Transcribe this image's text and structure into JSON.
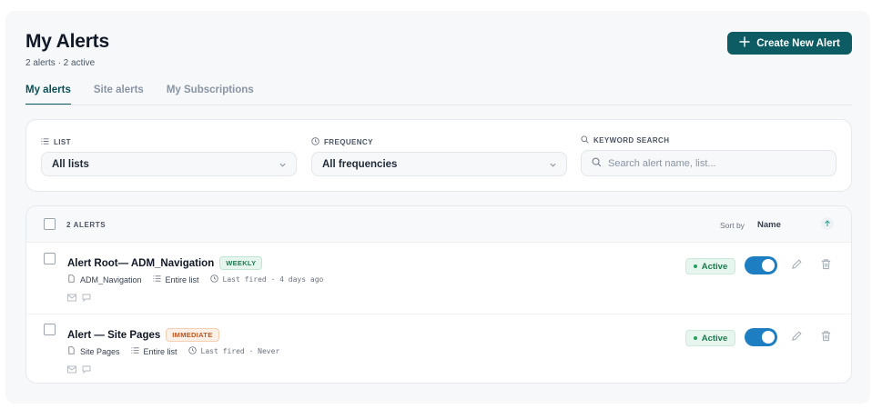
{
  "header": {
    "title": "My Alerts",
    "subtitle": "2 alerts · 2 active",
    "create_button": "Create New Alert"
  },
  "tabs": [
    {
      "label": "My alerts",
      "active": true
    },
    {
      "label": "Site alerts",
      "active": false
    },
    {
      "label": "My Subscriptions",
      "active": false
    }
  ],
  "filters": {
    "list": {
      "label": "LIST",
      "value": "All lists"
    },
    "frequency": {
      "label": "FREQUENCY",
      "value": "All frequencies"
    },
    "keyword": {
      "label": "KEYWORD SEARCH",
      "placeholder": "Search alert name, list..."
    }
  },
  "list_header": {
    "count_label": "2 ALERTS",
    "sort_by_label": "Sort by",
    "sort_value": "Name",
    "sort_direction": "ascending"
  },
  "alerts": [
    {
      "name": "Alert Root— ADM_Navigation",
      "frequency": "WEEKLY",
      "site": "ADM_Navigation",
      "scope": "Entire list",
      "last_fired": "Last fired · 4 days ago",
      "status": "Active",
      "enabled": true
    },
    {
      "name": "Alert — Site Pages",
      "frequency": "IMMEDIATE",
      "site": "Site Pages",
      "scope": "Entire list",
      "last_fired": "Last fired · Never",
      "status": "Active",
      "enabled": true
    }
  ],
  "colors": {
    "brand": "#0d5c63",
    "toggle_on": "#1e7ec2",
    "active_badge": "#1d7a4d",
    "weekly_badge": "#1d7a4d",
    "immediate_badge": "#c2531c"
  },
  "icons": {
    "create": "plus-icon",
    "list_filter": "list-icon",
    "frequency_filter": "clock-icon",
    "keyword_filter": "search-icon",
    "site": "document-icon",
    "scope": "list-icon",
    "last_fired": "clock-icon",
    "channel_email": "mail-icon",
    "channel_chat": "chat-icon",
    "edit": "pencil-icon",
    "delete": "trash-icon",
    "sort": "arrow-up-icon"
  }
}
